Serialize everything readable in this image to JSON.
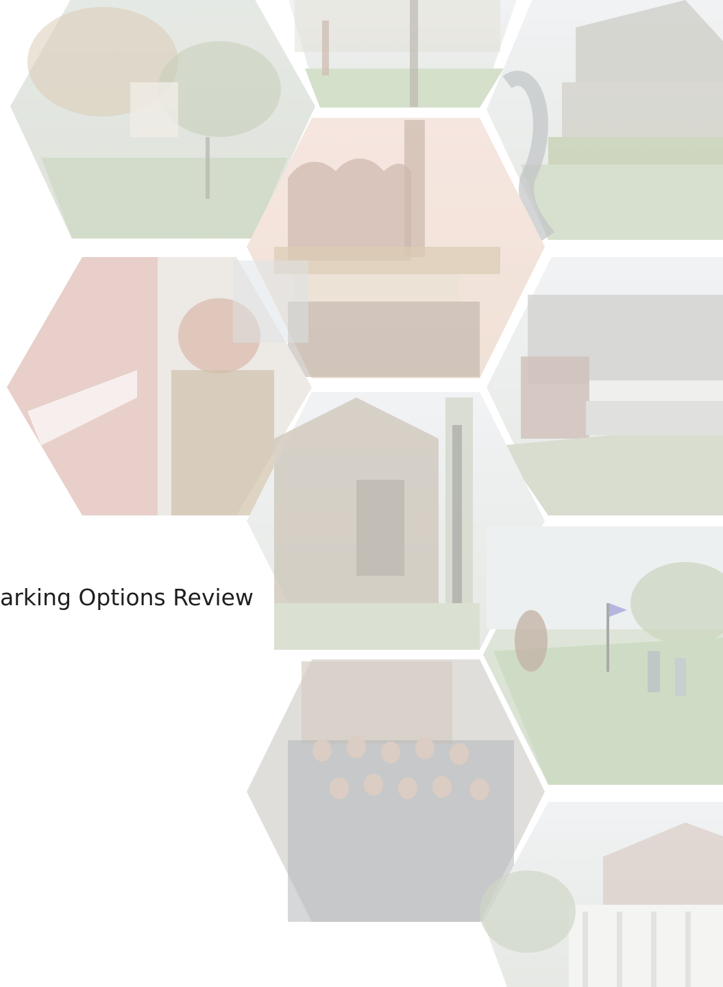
{
  "document": {
    "title": "arking Options Review"
  },
  "collage": {
    "tiles": [
      {
        "subject": "autumn-park-street",
        "color": "#a8b39a"
      },
      {
        "subject": "campus-walkway",
        "color": "#b7c1ac"
      },
      {
        "subject": "civic-building-sculpture",
        "color": "#b9bcb1"
      },
      {
        "subject": "historic-theater-marquee",
        "color": "#c9b8a6"
      },
      {
        "subject": "firefighter-and-truck",
        "color": "#d5b5ae"
      },
      {
        "subject": "recreation-center-parking",
        "color": "#c6c6c1"
      },
      {
        "subject": "old-school-building",
        "color": "#b9b8ad"
      },
      {
        "subject": "golf-putting-green",
        "color": "#bcc8b4"
      },
      {
        "subject": "police-department-group",
        "color": "#a9aaab"
      },
      {
        "subject": "white-colonial-house",
        "color": "#c9cbc6"
      }
    ]
  }
}
